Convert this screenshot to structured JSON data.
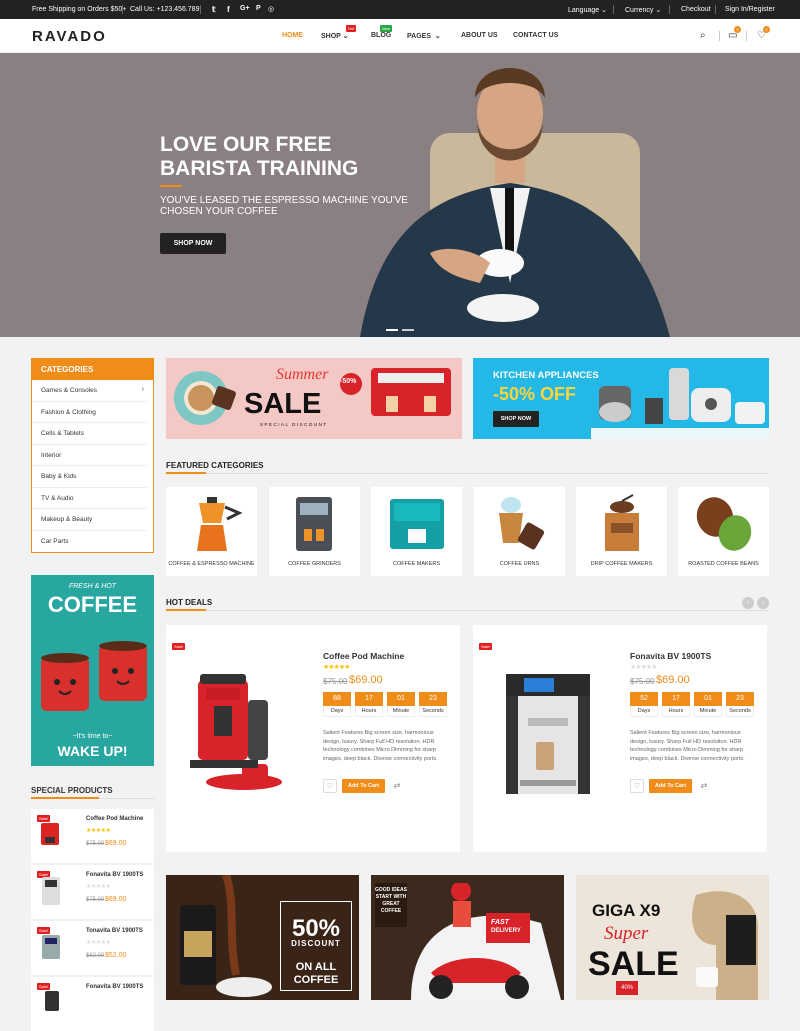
{
  "topbar": {
    "shipping": "Free Shipping on Orders $50+",
    "call": "Call Us: +123.456.789",
    "language": "Language",
    "currency": "Currency",
    "checkout": "Checkout",
    "signin": "Sign In/Register"
  },
  "header": {
    "logo": "RAVADO",
    "nav": [
      "HOME",
      "SHOP",
      "BLOG",
      "PAGES",
      "ABOUT US",
      "CONTACT US"
    ],
    "shop_tag": "Hot",
    "blog_tag": "New",
    "cart_count": "0",
    "wish_count": "0"
  },
  "hero": {
    "title": "LOVE OUR FREE BARISTA TRAINING",
    "subtitle": "YOU'VE LEASED THE ESPRESSO MACHINE YOU'VE CHOSEN YOUR COFFEE",
    "button": "SHOP NOW"
  },
  "categories": {
    "heading": "CATEGORIES",
    "items": [
      "Games & Consoles",
      "Fashion & Clothing",
      "Cells & Tablets",
      "Interior",
      "Baby & Kids",
      "TV & Audio",
      "Makeup & Beauty",
      "Car Parts"
    ]
  },
  "side_banner": {
    "top": "FRESH & HOT",
    "main": "COFFEE",
    "sub": "~It's time to~",
    "bottom": "WAKE UP!"
  },
  "promos": {
    "p1_script": "Summer",
    "p1_main": "SALE",
    "p1_badge": "-50%",
    "p1_small": "SPECIAL DISCOUNT",
    "p2_title": "KITCHEN APPLIANCES",
    "p2_off": "-50% OFF",
    "p2_button": "SHOP NOW"
  },
  "featured": {
    "heading": "FEATURED CATEGORIES",
    "items": [
      "COFFEE & ESPRESSO MACHINE",
      "COFFEE GRINDERS",
      "COFFEE MAKERS",
      "COFFEE URNS",
      "DRIP COFFEE MAKERS",
      "ROASTED COFFEE BEANS"
    ]
  },
  "hot_deals": {
    "heading": "HOT DEALS",
    "sale": "Sale!",
    "labels": [
      "Days",
      "Hours",
      "Minute",
      "Seconds"
    ],
    "add_to_cart": "Add To Cart",
    "deals": [
      {
        "name": "Coffee Pod Machine",
        "old": "$75.00",
        "price": "$69.00",
        "counts": [
          "88",
          "17",
          "01",
          "23"
        ],
        "rating": 5,
        "desc": "Salient Features Big screen size, harmonious design, luxury. Sharp Full HD resolution. HDR technology combines Micro Dimming for sharp images, deep black. Diverse connectivity ports."
      },
      {
        "name": "Fonavita BV 1900TS",
        "old": "$75.00",
        "price": "$69.00",
        "counts": [
          "52",
          "17",
          "01",
          "23"
        ],
        "rating": 0,
        "desc": "Salient Features Big screen size, harmonious design, luxury. Sharp Full HD resolution. HDR technology combines Micro Dimming for sharp images, deep black. Diverse connectivity ports."
      }
    ]
  },
  "special": {
    "heading": "SPECIAL PRODUCTS",
    "sale": "Sale!",
    "items": [
      {
        "name": "Coffee Pod Machine",
        "old": "$75.00",
        "price": "$69.00",
        "rating": 5
      },
      {
        "name": "Fonavita BV 1900TS",
        "old": "$75.00",
        "price": "$69.00",
        "rating": 0
      },
      {
        "name": "Tonavita BV 1900TS",
        "old": "$62.00",
        "price": "$52.00",
        "rating": 0
      },
      {
        "name": "Fonavita BV 1900TS",
        "old": "",
        "price": "",
        "rating": 0
      }
    ]
  },
  "bottom": {
    "b1_pct": "50%",
    "b1_disc": "DISCOUNT",
    "b1_on": "ON ALL",
    "b1_coffee": "COFFEE",
    "b2_sign": "GOOD IDEAS START WITH GREAT COFFEE",
    "b2_fast": "FAST",
    "b2_delivery": "DELIVERY",
    "b3_title": "GIGA X9",
    "b3_super": "Super",
    "b3_sale": "SALE",
    "b3_pct": "40%"
  },
  "colors": {
    "accent": "#f08c1a",
    "dark": "#222222",
    "sale": "#e02020"
  }
}
